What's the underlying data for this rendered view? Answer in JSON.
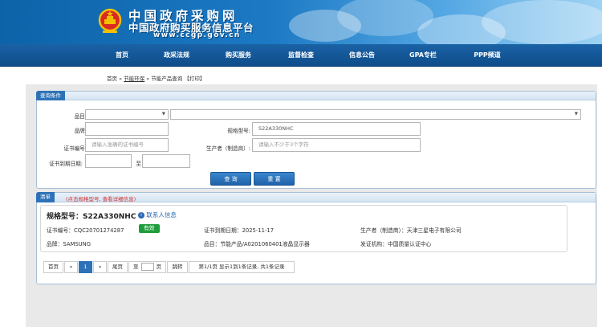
{
  "site": {
    "title_cn": "中国政府采购网",
    "subtitle_cn": "中国政府购买服务信息平台",
    "url": "www.ccgp.gov.cn"
  },
  "nav": {
    "items": [
      "首页",
      "政采法规",
      "购买服务",
      "监督检查",
      "信息公告",
      "GPA专栏",
      "PPP频道"
    ]
  },
  "breadcrumb": {
    "home": "首页",
    "sep1": "»",
    "energy": "节能环保",
    "sep2": "»",
    "current": "节能产品查询",
    "print": "【打印】"
  },
  "query": {
    "section_title": "查询条件",
    "category_label": "品目:",
    "brand_label": "品牌:",
    "model_label": "规格型号:",
    "model_value": "S22A330NHC",
    "cert_label": "证书编号:",
    "cert_placeholder": "请输入准确的证书编号",
    "maker_label": "生产者（制造商）:",
    "maker_placeholder": "请输入不少于3个字符",
    "expiry_label": "证书到期日期:",
    "to_label": "至",
    "search_btn": "查 询",
    "reset_btn": "重 置"
  },
  "results": {
    "section_title": "清单",
    "hint": "(点击规格型号, 查看详细信息)",
    "item": {
      "model_title": "规格型号：S22A330NHC",
      "contact": "联系人信息",
      "cert": "证书编号：CQC20701274287",
      "status": "有效",
      "expiry": "证书到期日期：2025-11-17",
      "maker": "生产者（制造商）：天津三星电子有限公司",
      "brand": "品牌：SAMSUNG",
      "category": "品目：节能产品/A0201060401液晶显示器",
      "issuer": "发证机构：中国质量认证中心"
    }
  },
  "pager": {
    "first": "首页",
    "prev": "«",
    "current": "1",
    "next": "»",
    "last": "尾页",
    "goto_pre": "至",
    "goto_post": "页",
    "jump": "跳转",
    "info": "第1/1页  显示1到1条记录, 共1条记录"
  },
  "colors": {
    "brand_blue": "#1a62a5",
    "status_green": "#1f9d3c",
    "hint_red": "#d0312d"
  }
}
